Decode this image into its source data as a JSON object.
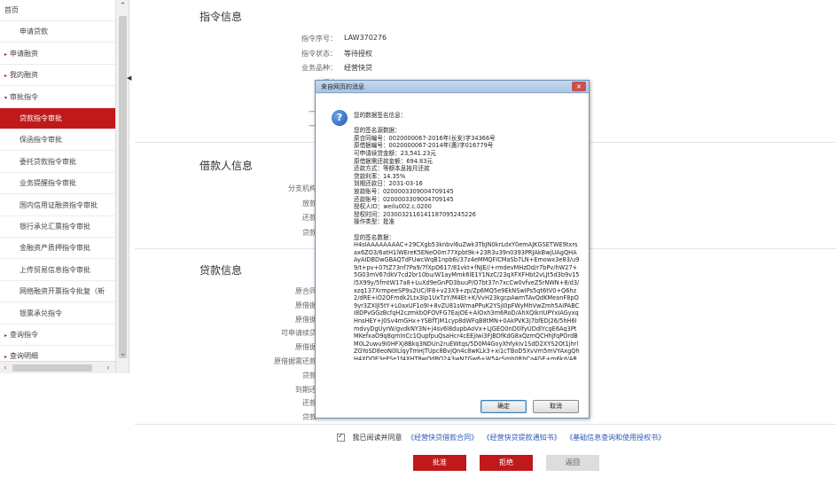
{
  "sidebar": {
    "items": [
      {
        "label": "首页",
        "type": "top",
        "arrow": ""
      },
      {
        "label": "申请贷款",
        "type": "sub",
        "arrow": ""
      },
      {
        "label": "申请融资",
        "type": "top",
        "arrow": "▸"
      },
      {
        "label": "我的融资",
        "type": "top",
        "arrow": "▸"
      },
      {
        "label": "审批指令",
        "type": "top",
        "arrow": "▾"
      },
      {
        "label": "贷款指令审批",
        "type": "sub",
        "arrow": "",
        "active": true
      },
      {
        "label": "保函指令审批",
        "type": "sub",
        "arrow": ""
      },
      {
        "label": "委托贷款指令审批",
        "type": "sub",
        "arrow": ""
      },
      {
        "label": "业务提醒指令审批",
        "type": "sub",
        "arrow": ""
      },
      {
        "label": "国内信用证融资指令审批",
        "type": "sub",
        "arrow": ""
      },
      {
        "label": "银行承兑汇票指令审批",
        "type": "sub",
        "arrow": ""
      },
      {
        "label": "金融资产质押指令审批",
        "type": "sub",
        "arrow": ""
      },
      {
        "label": "上传贸易信息指令审批",
        "type": "sub",
        "arrow": ""
      },
      {
        "label": "网络融资开票指令批复（新",
        "type": "sub",
        "arrow": ""
      },
      {
        "label": "银票承兑指令",
        "type": "sub",
        "arrow": ""
      },
      {
        "label": "查询指令",
        "type": "top",
        "arrow": "▸"
      },
      {
        "label": "查询明细",
        "type": "top",
        "arrow": "▸"
      }
    ]
  },
  "main": {
    "section1_title": "指令信息",
    "instruction_fields": [
      {
        "label": "指令序号：",
        "value": "LAW370276"
      },
      {
        "label": "指令状态：",
        "value": "等待授权"
      },
      {
        "label": "业务品种：",
        "value": "经营快贷"
      },
      {
        "label": "提交",
        "value": ""
      },
      {
        "label": "提交",
        "value": ""
      },
      {
        "label": "一次授权",
        "value": ""
      },
      {
        "label": "一次授权",
        "value": ""
      }
    ],
    "section2_title": "借款人信息",
    "borrower_fields": [
      {
        "label": "分支机构"
      },
      {
        "label": "放款"
      },
      {
        "label": "还款"
      },
      {
        "label": "贷款"
      }
    ],
    "section3_title": "贷款信息",
    "loan_fields": [
      {
        "label": "原合同"
      },
      {
        "label": "原借据"
      },
      {
        "label": "原借据"
      },
      {
        "label": "可申请续贷"
      },
      {
        "label": "原借据"
      },
      {
        "label": "原借据需还款"
      },
      {
        "label": "贷款"
      },
      {
        "label": "到期还"
      },
      {
        "label": "还款"
      },
      {
        "label": "贷款"
      }
    ],
    "agree_text": "我已阅读并同意",
    "links": [
      "《经营快贷借款合同》",
      "《经营快贷提款通知书》",
      "《基础信息查询和使用授权书》"
    ],
    "buttons": {
      "approve": "批准",
      "reject": "拒绝",
      "back": "返回"
    }
  },
  "dialog": {
    "title": "来自网页的消息",
    "close": "×",
    "icon": "info-icon",
    "lines": [
      "您的数据签名信息：",
      "",
      "您的签名源数据：",
      "原合同编号：0020000067-2016年(长安)字34366号",
      "原借据编号：0020000067-2014年(惠)字016779号",
      "可申请续贷金额：23,541.23元",
      "原借据需还款金额：694.83元",
      "还款方式：等额本息按月还款",
      "贷款利率：14.35%",
      "到期还款日：2031-03-16",
      "放款账号：0200003309004709145",
      "还款账号：0200003309004709145",
      "授权人ID：weilu002.c.0200",
      "授权时间：20300321161411870952452​26",
      "操作类型：批准",
      "",
      "您的签名数据："
    ],
    "signature": "H4sIAAAAAAAAC+29CXgb53knbvl6uZwk3TbJN0krLdxY0emAJKGSETWE9txrsax6ZO3/6atH1lWEreK5ENeO0m77Xpbt9k+23R3u39n0393PRJAkBwjUAgQHAAyAIDBDwGBAQTdFUwcWqB1npb6i/37z4eMMQFICMaSb7LN+Emowx3e83/u99/t+pv+07tZ73nf7Pa9/7fXpD617/81vkt+fNJE//+rmdevMHzDd/r7bPv/hW27+5G03mV67dkV7cd2br10bu/W1ayMmk6lE1Y1NzC/23qXFXFHbt2vLJt5d3b9v15l5X99y/5fmtW17a8+LuXd9eGnPD3buuP/O7bt37n7xcCw0vfveZ5rNWN+8/d3/xzq137XrmpeeSP9u2UC/lF8+v23X9+zp/Zp6MQ5e9EkNSwIPs5qt6tV0+Q6hz2/dRE+iO2OFmdk2Ltx3Ip1UxTzY/M4Et+K/VvH23kgcpAwmTAvQdKMeanF8pO9yr3ZXIJl5tY+L0axUF1o9I+8vZU81sWmaPPuK2YSjI0pFWyMhVwZmh5AIPABCI8DPvGGzBcfqH2czmkbOFOVFG7EajOE+AIOxh3m6RoD/AhXQIkrIUPYxIAGyxqHnsHEY+J0Sv4mGHx+YSBfTjM1cyp8dWFqB8tMN+0AkPVK3j7bfEDj26/5hH6lmdvyDgUyrW/gvdkNY3N+j4sv6l8dupbAoVx+LJGEO0nD0lfyUDdlYcqE6Aq3PtMKefxaO9q8qmInCc1QupfpuQsaHcr4cEEjIwi3FJBDfKdG8xQzmQCHhJfqPOrdBM0L2uwu9I0HFXj8Bkq3NDUn2ruEWtqs/5D0M4GoyXhfykIv1SdD2XYS2Ot1jhrlZGYoSD8eoN0lLlqyTmHjTUpc8BvjQn4c8wKLk3+xi1cTBoD5XvVm5mVYAxgQhH4XDOE3eFSe1f4XHT8wQdBO2A3wN7Gw6+W5ArSmb0RhCa4GE+m6kd/AR5q3L/VhLrzXPlZJE3X7dFcEUW5TG1V7sLVYoLbgxGDhXJW2Y7uN6l4Km8HDYv9sNN3LhGGPFbU3OGZ5r/QgF5BMbn4zNZ4W8SYn5S7fZPD25pXRBxd4KJLOnDfT2eyD+4zBYO4FSRuTB2VhuaJOPHCLHGqDgtOcCK7pBZ+U3nZUNcHVHf2GE7jw1AOaRkdoS3ByWkhhgUJWKbpJOE0cGHyKt7jJ3Q8QNAcJZ6LWwU0SK3oOGmLYEc0XtBQ1bGdTFSyJmC2iavYrpDCMcE4nwlw+Sn3N9aTxnewrKgaeCjJRRnJkG1+c0bBDIRwPUJsnqc6Apy5WzAdBtGhFxTXQfWIbQzvL0aW4ZnzkNK4sJrHPKY1O5ogT5n1EvQbGBxTI1Wc0LNSGL9C0Y3RO2hzRj3nVYjYEkgOdZYZiKtLHLq6kPAqtXL6nxdAAmFhBh7LFVBeXuBW9ZfYWN/qnMjsAbZ8y+ZKgaxYU0wThBezuXRkNNdwYB6PuKjxj0MEPFgYdjdNhvjbz0bVEUc+U2FPmH47ahoXwNgr1n71mlGCRfnKgMRUHhvE4uQl9gG4pm9K5eQ+nV1K6JNi+nsV",
    "buttons": {
      "ok": "确定",
      "cancel": "取消"
    }
  }
}
